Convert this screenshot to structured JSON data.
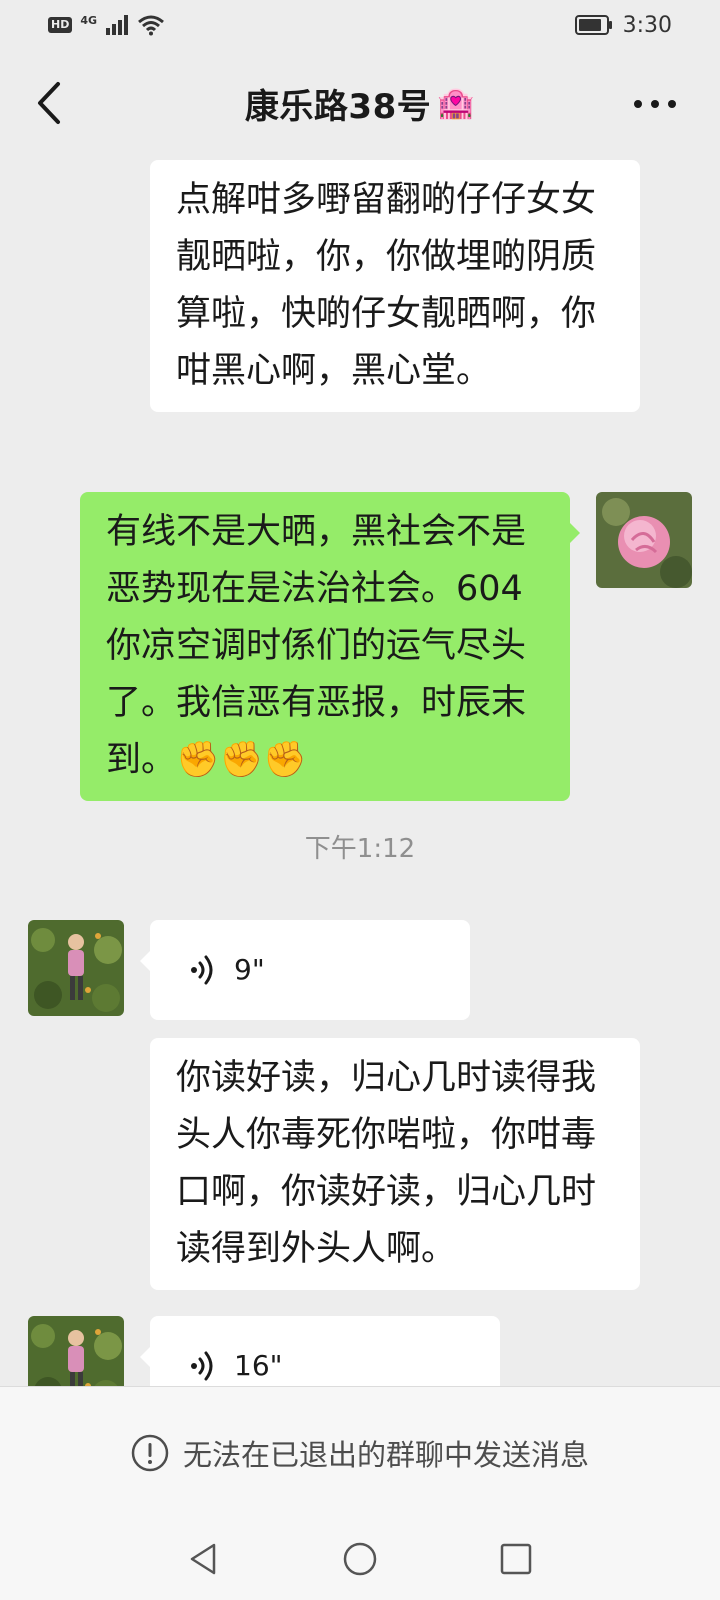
{
  "status_bar": {
    "network_badge": "HD",
    "network_type": "4G",
    "time": "3:30"
  },
  "header": {
    "title": "康乐路38号",
    "title_emoji": "🏩",
    "back_icon": "chevron-left-icon",
    "more_icon": "more-dots-icon"
  },
  "messages": [
    {
      "side": "left",
      "type": "text",
      "text": "点解咁多嘢留翻啲仔仔女女靓晒啦，你，你做埋啲阴质算啦，快啲仔女靓晒啊，你咁黑心啊，黑心堂。"
    },
    {
      "side": "right",
      "type": "text",
      "text": "有线不是大晒，黑社会不是恶势现在是法治社会。604你凉空调时係们的运气尽头了。我信恶有恶报，时辰末到。✊✊✊"
    },
    {
      "type": "time",
      "text": "下午1:12"
    },
    {
      "side": "left",
      "type": "voice",
      "duration": "9\""
    },
    {
      "side": "left",
      "type": "text",
      "text": "你读好读，归心几时读得我头人你毒死你啱啦，你咁毒口啊，你读好读，归心几时读得到外头人啊。"
    },
    {
      "side": "left",
      "type": "voice",
      "duration": "16\""
    }
  ],
  "footer": {
    "notice": "无法在已退出的群聊中发送消息",
    "notice_icon": "info-icon"
  },
  "colors": {
    "background": "#ededed",
    "own_bubble": "#95ec69",
    "other_bubble": "#ffffff"
  }
}
